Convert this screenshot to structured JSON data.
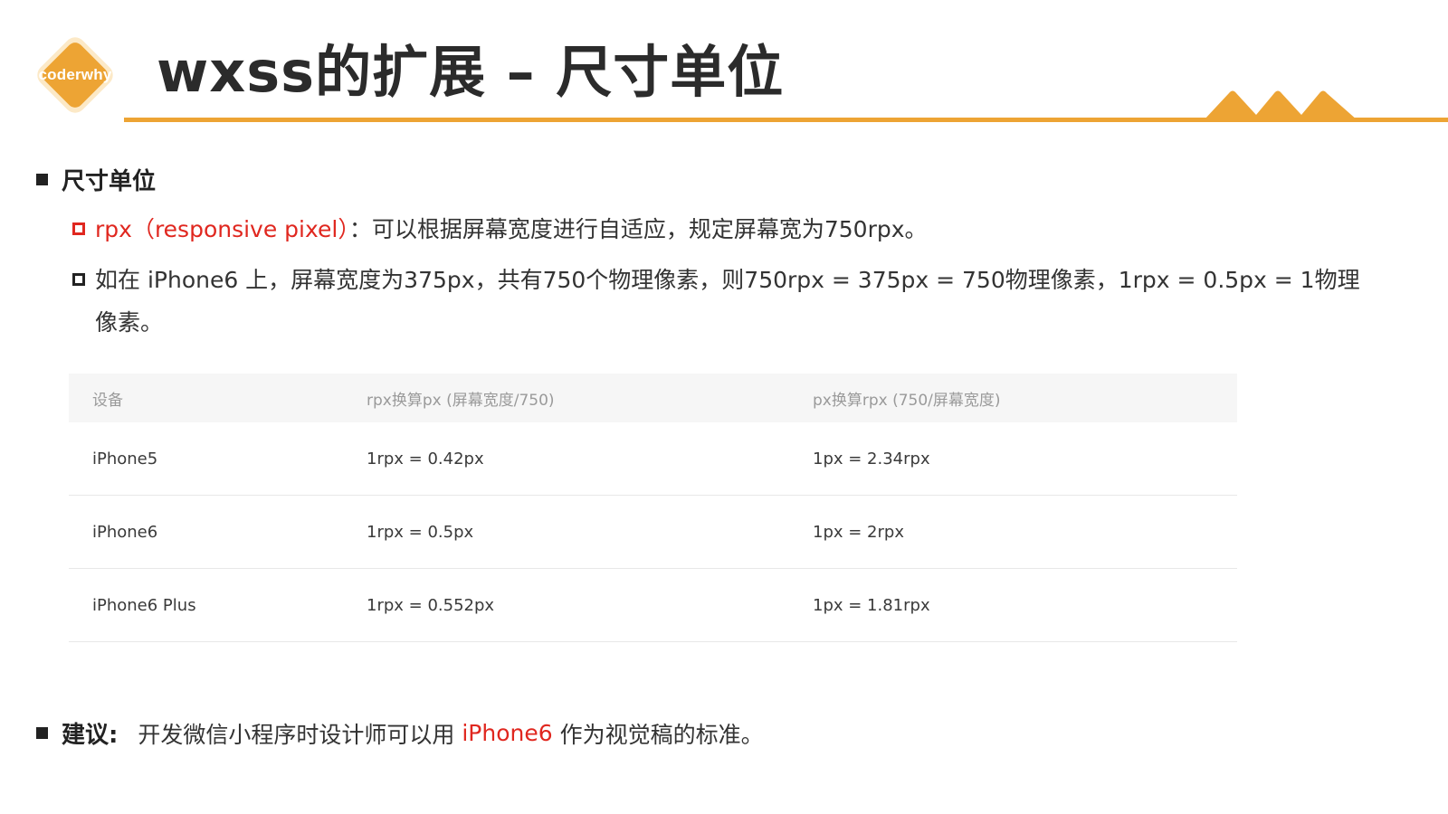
{
  "logo": {
    "text": "coderwhy"
  },
  "title": "wxss的扩展 – 尺寸单位",
  "colors": {
    "accent": "#eda434",
    "red": "#e0271f"
  },
  "section": {
    "heading": "尺寸单位"
  },
  "points": [
    {
      "red_part": "rpx（responsive pixel）",
      "rest": "：可以根据屏幕宽度进行自适应，规定屏幕宽为750rpx。"
    },
    {
      "line1": "如在 iPhone6 上，屏幕宽度为375px，共有750个物理像素，则750rpx = 375px = 750物理像素，1rpx =  0.5px = 1物理",
      "line2": "像素。"
    }
  ],
  "table": {
    "headers": [
      "设备",
      "rpx换算px (屏幕宽度/750)",
      "px换算rpx (750/屏幕宽度)"
    ],
    "rows": [
      [
        "iPhone5",
        "1rpx = 0.42px",
        "1px = 2.34rpx"
      ],
      [
        "iPhone6",
        "1rpx = 0.5px",
        "1px = 2rpx"
      ],
      [
        "iPhone6 Plus",
        "1rpx = 0.552px",
        "1px = 1.81rpx"
      ]
    ]
  },
  "suggestion": {
    "label": "建议:",
    "before": "开发微信小程序时设计师可以用 ",
    "highlight": "iPhone6",
    "after": " 作为视觉稿的标准。"
  }
}
